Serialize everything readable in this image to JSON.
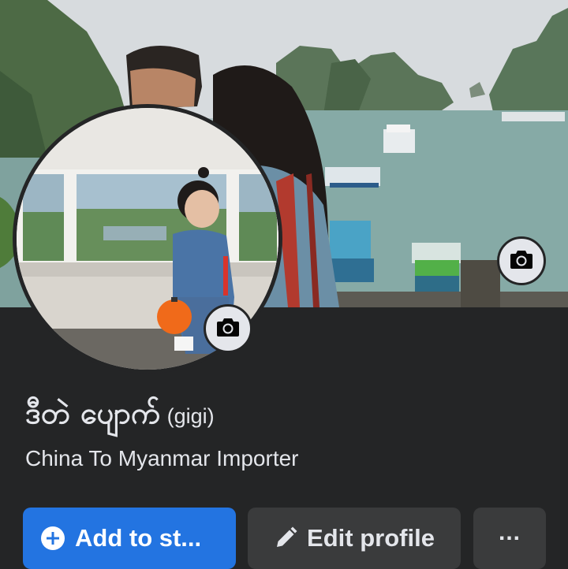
{
  "profile": {
    "name": "ဒီတဲ ပျောက်",
    "nickname": "(gigi)",
    "bio": "China To Myanmar Importer"
  },
  "actions": {
    "add_story_label": "Add to st...",
    "edit_profile_label": "Edit profile",
    "more_label": "..."
  },
  "icons": {
    "cover_camera": "camera-icon",
    "avatar_camera": "camera-icon",
    "add_story": "plus-circle-icon",
    "edit_profile": "pencil-icon",
    "more": "more-horizontal-icon"
  },
  "colors": {
    "background": "#242526",
    "primary_button": "#2374e1",
    "secondary_button": "#3a3b3c",
    "text": "#e4e6eb"
  }
}
